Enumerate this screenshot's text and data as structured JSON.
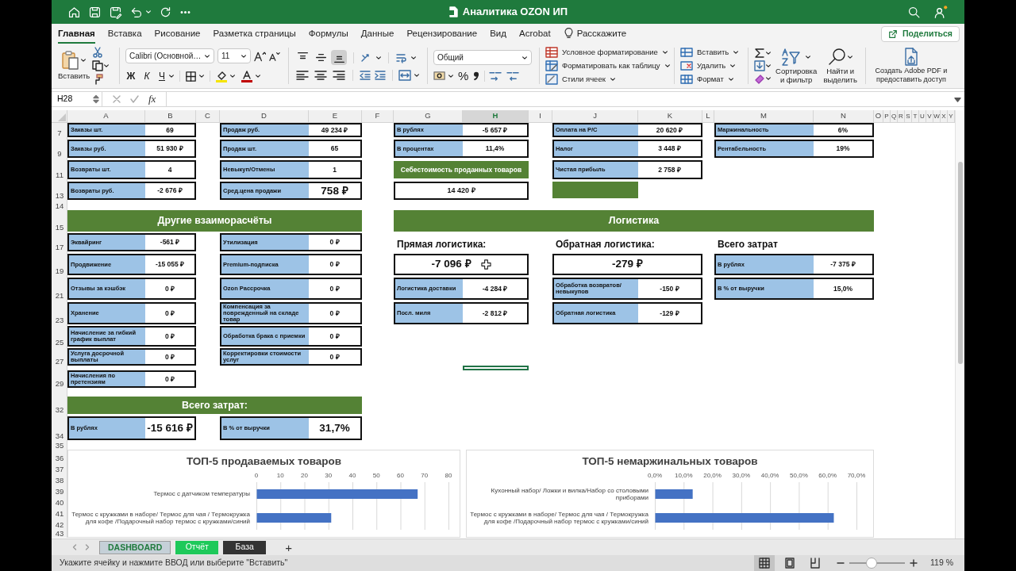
{
  "window": {
    "title": "Аналитика OZON ИП"
  },
  "tabs": [
    {
      "label": "Главная",
      "selected": true
    },
    {
      "label": "Вставка",
      "selected": false
    },
    {
      "label": "Рисование",
      "selected": false
    },
    {
      "label": "Разметка страницы",
      "selected": false
    },
    {
      "label": "Формулы",
      "selected": false
    },
    {
      "label": "Данные",
      "selected": false
    },
    {
      "label": "Рецензирование",
      "selected": false
    },
    {
      "label": "Вид",
      "selected": false
    },
    {
      "label": "Acrobat",
      "selected": false
    }
  ],
  "tell_me": "Расскажите",
  "share_button": "Поделиться",
  "ribbon": {
    "paste": "Вставить",
    "font_name": "Calibri (Основной…",
    "font_size": "11",
    "bold": "Ж",
    "italic": "К",
    "underline": "Ч",
    "vertical_align": [
      {
        "selected": false
      },
      {
        "selected": false
      },
      {
        "selected": true
      }
    ],
    "number_format": "Общий",
    "percent": "%",
    "styles": [
      "Условное форматирование",
      "Форматировать как таблицу",
      "Стили ячеек"
    ],
    "cells": [
      "Вставить",
      "Удалить",
      "Формат"
    ],
    "sort_filter": "Сортировка и фильтр",
    "find_select": "Найти и выделить",
    "adobe_pdf": "Создать Adobe PDF и предоставить доступ"
  },
  "name_box": "H28",
  "formula_fx": "fx",
  "columns": [
    {
      "label": "A",
      "selected": false
    },
    {
      "label": "B",
      "selected": false
    },
    {
      "label": "C",
      "selected": false
    },
    {
      "label": "D",
      "selected": false
    },
    {
      "label": "E",
      "selected": false
    },
    {
      "label": "F",
      "selected": false
    },
    {
      "label": "G",
      "selected": false
    },
    {
      "label": "H",
      "selected": true
    },
    {
      "label": "I",
      "selected": false
    },
    {
      "label": "J",
      "selected": false
    },
    {
      "label": "K",
      "selected": false
    },
    {
      "label": "L",
      "selected": false
    },
    {
      "label": "M",
      "selected": false
    },
    {
      "label": "N",
      "selected": false
    },
    {
      "label": "O",
      "selected": false
    },
    {
      "label": "P",
      "selected": false
    },
    {
      "label": "Q",
      "selected": false
    },
    {
      "label": "R",
      "selected": false
    },
    {
      "label": "S",
      "selected": false
    },
    {
      "label": "T",
      "selected": false
    },
    {
      "label": "U",
      "selected": false
    },
    {
      "label": "V",
      "selected": false
    },
    {
      "label": "W",
      "selected": false
    },
    {
      "label": "X",
      "selected": false
    },
    {
      "label": "Y",
      "selected": false
    }
  ],
  "row_headers": [
    "7",
    "9",
    "11",
    "13",
    "14",
    "15",
    "17",
    "19",
    "21",
    "23",
    "25",
    "27",
    "29",
    "32",
    "34",
    "35",
    "36",
    "37",
    "38",
    "39",
    "40",
    "41",
    "42",
    "43"
  ],
  "cells": [
    {
      "kind": "metric",
      "label": "Заказы шт.",
      "value": "69",
      "large": false
    },
    {
      "kind": "metric",
      "label": "Продаж руб.",
      "value": "49 234 ₽",
      "large": false
    },
    {
      "kind": "metric",
      "label": "В рублях",
      "value": "-5 657 ₽",
      "large": false
    },
    {
      "kind": "metric",
      "label": "Оплата на Р/С",
      "value": "20 620 ₽",
      "large": false
    },
    {
      "kind": "metric",
      "label": "Маржинальность",
      "value": "6%",
      "large": false
    },
    {
      "kind": "metric",
      "label": "Заказы руб.",
      "value": "51 930 ₽",
      "large": false
    },
    {
      "kind": "metric",
      "label": "Продаж шт.",
      "value": "65",
      "large": false
    },
    {
      "kind": "metric",
      "label": "В процентах",
      "value": "11,4%",
      "large": false
    },
    {
      "kind": "metric",
      "label": "Налог",
      "value": "3 448 ₽",
      "large": false
    },
    {
      "kind": "metric",
      "label": "Рентабельность",
      "value": "19%",
      "large": false
    },
    {
      "kind": "metric",
      "label": "Возвраты шт.",
      "value": "4",
      "large": false
    },
    {
      "kind": "metric",
      "label": "Невыкуп/Отмены",
      "value": "1",
      "large": false
    },
    {
      "kind": "header",
      "text": "Себестоимость проданных товаров"
    },
    {
      "kind": "metric",
      "label": "Чистая прибыль",
      "value": "2 758 ₽",
      "large": false
    },
    {
      "kind": "metric",
      "label": "Возвраты руб.",
      "value": "-2 676 ₽",
      "large": false
    },
    {
      "kind": "metric",
      "label": "Сред.цена продажи",
      "value": "758 ₽",
      "large": true
    },
    {
      "kind": "value",
      "value": "14 420 ₽",
      "large": false
    },
    {
      "kind": "filler"
    },
    {
      "kind": "header",
      "text": "Другие взаиморасчёты"
    },
    {
      "kind": "header",
      "text": "Логистика"
    },
    {
      "kind": "metric",
      "label": "Эквайринг",
      "value": "-561 ₽",
      "large": false
    },
    {
      "kind": "metric",
      "label": "Утилизация",
      "value": "0 ₽",
      "large": false
    },
    {
      "kind": "title",
      "text": "Прямая логистика:"
    },
    {
      "kind": "title",
      "text": "Обратная логистика:"
    },
    {
      "kind": "title",
      "text": "Всего затрат"
    },
    {
      "kind": "metric",
      "label": "Продвижение",
      "value": "-15 055 ₽",
      "large": false
    },
    {
      "kind": "metric",
      "label": "Premium-подписка",
      "value": "0 ₽",
      "large": false
    },
    {
      "kind": "value",
      "value": "-7 096 ₽",
      "large": true
    },
    {
      "kind": "value",
      "value": "-279 ₽",
      "large": true
    },
    {
      "kind": "metric",
      "label": "В рублях",
      "value": "-7 375 ₽",
      "large": false
    },
    {
      "kind": "metric",
      "label": "Отзывы за кэшбэк",
      "value": "0 ₽",
      "large": false
    },
    {
      "kind": "metric",
      "label": "Ozon Рассрочка",
      "value": "0 ₽",
      "large": false
    },
    {
      "kind": "metric",
      "label": "Логистика доставки",
      "value": "-4 284 ₽",
      "large": false
    },
    {
      "kind": "metric",
      "label": "Обработка возвратов/невыкупов",
      "value": "-150 ₽",
      "large": false
    },
    {
      "kind": "metric",
      "label": "В % от выручки",
      "value": "15,0%",
      "large": false
    },
    {
      "kind": "metric",
      "label": "Хранение",
      "value": "0 ₽",
      "large": false
    },
    {
      "kind": "metric",
      "label": "Компенсация за поврежденный на складе товар",
      "value": "0 ₽",
      "large": false
    },
    {
      "kind": "metric",
      "label": "Посл. миля",
      "value": "-2 812 ₽",
      "large": false
    },
    {
      "kind": "metric",
      "label": "Обратная логистика",
      "value": "-129 ₽",
      "large": false
    },
    {
      "kind": "metric",
      "label": "Начисление за гибкий график выплат",
      "value": "0 ₽",
      "large": false
    },
    {
      "kind": "metric",
      "label": "Обработка брака с приемки",
      "value": "0 ₽",
      "large": false
    },
    {
      "kind": "metric",
      "label": "Услуга досрочной выплаты",
      "value": "0 ₽",
      "large": false
    },
    {
      "kind": "metric",
      "label": "Корректировки стоимости услуг",
      "value": "0 ₽",
      "large": false
    },
    {
      "kind": "metric",
      "label": "Начисления по претензиям",
      "value": "0 ₽",
      "large": false
    },
    {
      "kind": "header",
      "text": "Всего затрат:"
    },
    {
      "kind": "metric",
      "label": "В рублях",
      "value": "-15 616 ₽",
      "large": true
    },
    {
      "kind": "metric",
      "label": "В % от выручки",
      "value": "31,7%",
      "large": true
    }
  ],
  "charts": [
    {
      "chart_data": {
        "type": "bar",
        "orientation": "horizontal",
        "title": "ТОП-5 продаваемых товаров",
        "categories": [
          "Термос с датчиком температуры",
          "Термос с кружками в наборе/ Термос для чая / Термокружка для кофе /Подарочный набор термос с кружками/синий"
        ],
        "values": [
          67,
          31
        ],
        "grid": true,
        "xlim": [
          0,
          80
        ],
        "xticks": [
          0,
          10,
          20,
          30,
          40,
          50,
          60,
          70,
          80
        ]
      }
    },
    {
      "chart_data": {
        "type": "bar",
        "orientation": "horizontal",
        "title": "ТОП-5 немаржинальных товаров",
        "categories": [
          "Кухонный набор/ Ложки и вилка/Набор со столовыми приборами",
          "Термос с кружками в наборе/ Термос для чая / Термокружка для кофе /Подарочный набор термос с кружками/синий"
        ],
        "values": [
          0.13,
          0.62
        ],
        "grid": true,
        "xlim": [
          0,
          0.7
        ],
        "xticks": [
          {
            "value": 0,
            "label": "0,0%"
          },
          {
            "value": 0.1,
            "label": "10,0%"
          },
          {
            "value": 0.2,
            "label": "20,0%"
          },
          {
            "value": 0.3,
            "label": "30,0%"
          },
          {
            "value": 0.4,
            "label": "40,0%"
          },
          {
            "value": 0.5,
            "label": "50,0%"
          },
          {
            "value": 0.6,
            "label": "60,0%"
          },
          {
            "value": 0.7,
            "label": "70,0%"
          }
        ]
      }
    }
  ],
  "sheets": [
    {
      "name": "DASHBOARD",
      "selected": true,
      "color": "#c5d0d8"
    },
    {
      "name": "Отчёт",
      "selected": false,
      "color": "#1ec95a"
    },
    {
      "name": "База",
      "selected": false,
      "color": "#333333"
    }
  ],
  "add_sheet": "+",
  "status_message": "Укажите ячейку и нажмите ВВОД или выберите \"Вставить\"",
  "view_buttons": [
    {
      "kind": "normal",
      "selected": true
    },
    {
      "kind": "page_layout",
      "selected": false
    },
    {
      "kind": "page_break",
      "selected": false
    }
  ],
  "zoom": {
    "level": 0.4,
    "reading": "119 %"
  }
}
